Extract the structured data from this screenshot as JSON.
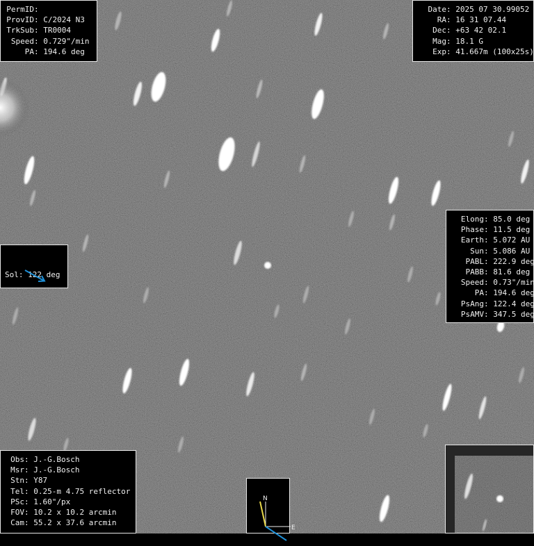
{
  "top_left": [
    {
      "label": "PermID",
      "value": ""
    },
    {
      "label": "ProvID",
      "value": "C/2024 N3"
    },
    {
      "label": "TrkSub",
      "value": "TR0004"
    },
    {
      "label": "Speed",
      "value": "0.729\"/min"
    },
    {
      "label": "PA",
      "value": "194.6 deg"
    }
  ],
  "top_right": [
    {
      "label": "Date",
      "value": "2025 07 30.99052"
    },
    {
      "label": "RA",
      "value": "16 31 07.44"
    },
    {
      "label": "Dec",
      "value": "+63 42 02.1"
    },
    {
      "label": "Mag",
      "value": "18.1 G"
    },
    {
      "label": "Exp",
      "value": "41.667m (100x25s)"
    }
  ],
  "right_panel": [
    {
      "label": "Elong",
      "value": "85.0 deg"
    },
    {
      "label": "Phase",
      "value": "11.5 deg"
    },
    {
      "label": "Earth",
      "value": "5.072 AU"
    },
    {
      "label": "Sun",
      "value": "5.086 AU"
    },
    {
      "label": "PABL",
      "value": "222.9 deg"
    },
    {
      "label": "PABB",
      "value": "81.6 deg"
    },
    {
      "label": "Speed",
      "value": "0.73\"/min"
    },
    {
      "label": "PA",
      "value": "194.6 deg"
    },
    {
      "label": "PsAng",
      "value": "122.4 deg"
    },
    {
      "label": "PsAMV",
      "value": "347.5 deg"
    }
  ],
  "sol": {
    "label": "Sol",
    "value": "122 deg"
  },
  "bottom_left": [
    {
      "label": "Obs",
      "value": "J.-G.Bosch"
    },
    {
      "label": "Msr",
      "value": "J.-G.Bosch"
    },
    {
      "label": "Stn",
      "value": "Y87"
    },
    {
      "label": "Tel",
      "value": "0.25-m 4.75 reflector"
    },
    {
      "label": "PSc",
      "value": "1.60\"/px"
    },
    {
      "label": "FOV",
      "value": "10.2 x 10.2 arcmin"
    },
    {
      "label": "Cam",
      "value": "55.2 x 37.6 arcmin"
    }
  ],
  "compass": {
    "north": "N",
    "east": "E"
  },
  "colors": {
    "sol_arrow": "#1e90d8",
    "motion_arrow": "#e8d84a",
    "sun_arrow": "#1e90d8"
  }
}
